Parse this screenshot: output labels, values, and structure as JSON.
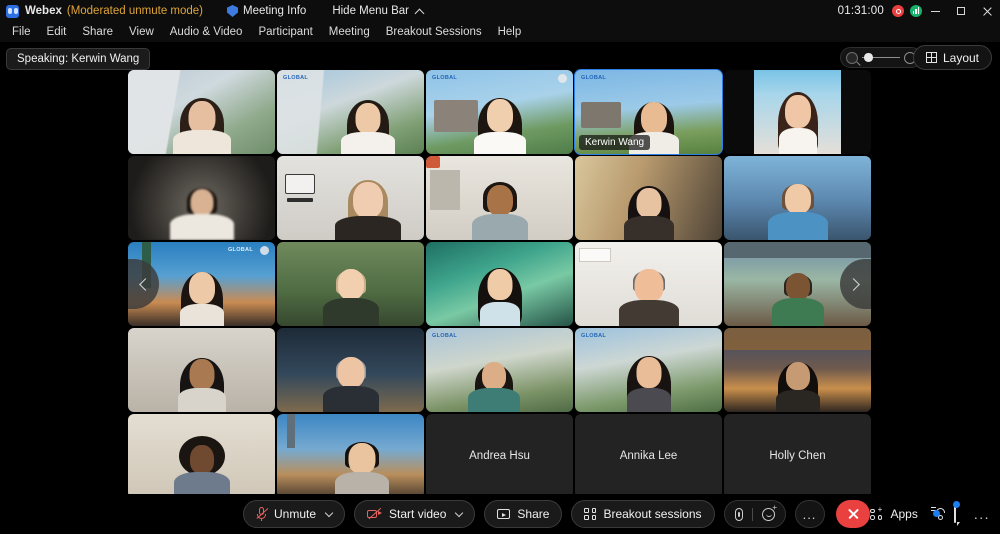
{
  "titlebar": {
    "app_name": "Webex",
    "mode_note": "(Moderated unmute mode)",
    "meeting_info": "Meeting Info",
    "hide_menu_bar": "Hide Menu Bar",
    "timer": "01:31:00",
    "recording_icon": "record-dot-icon",
    "signal_icon": "signal-strength-icon",
    "minimize": "minimize-icon",
    "maximize": "maximize-icon",
    "close": "close-icon"
  },
  "menubar": {
    "items": [
      {
        "label": "File"
      },
      {
        "label": "Edit"
      },
      {
        "label": "Share"
      },
      {
        "label": "View"
      },
      {
        "label": "Audio & Video"
      },
      {
        "label": "Participant"
      },
      {
        "label": "Meeting"
      },
      {
        "label": "Breakout Sessions"
      },
      {
        "label": "Help"
      }
    ]
  },
  "stage": {
    "speaking_label": "Speaking: Kerwin Wang",
    "active_speaker_name": "Kerwin Wang",
    "layout_button": "Layout",
    "zoom_out_icon": "zoom-out-icon",
    "zoom_in_icon": "zoom-in-icon",
    "prev_page_icon": "chevron-left-icon",
    "next_page_icon": "chevron-right-icon",
    "named_tiles": [
      {
        "name": "Andrea Hsu"
      },
      {
        "name": "Annika Lee"
      },
      {
        "name": "Holly Chen"
      }
    ]
  },
  "toolbar": {
    "unmute": "Unmute",
    "start_video": "Start video",
    "share": "Share",
    "breakout_sessions": "Breakout sessions",
    "apps": "Apps",
    "more": "...",
    "more_options": "...",
    "mic_test_icon": "microphone-icon",
    "reactions_icon": "reactions-icon",
    "leave_icon": "close-icon",
    "participants_icon": "participants-icon",
    "chat_icon": "chat-bubble-icon"
  },
  "colors": {
    "accent_blue": "#2f7fe8",
    "alert_red": "#e8413f",
    "mode_amber": "#e0a536",
    "badge_blue": "#1d7ef2",
    "signal_green": "#17b26a"
  }
}
